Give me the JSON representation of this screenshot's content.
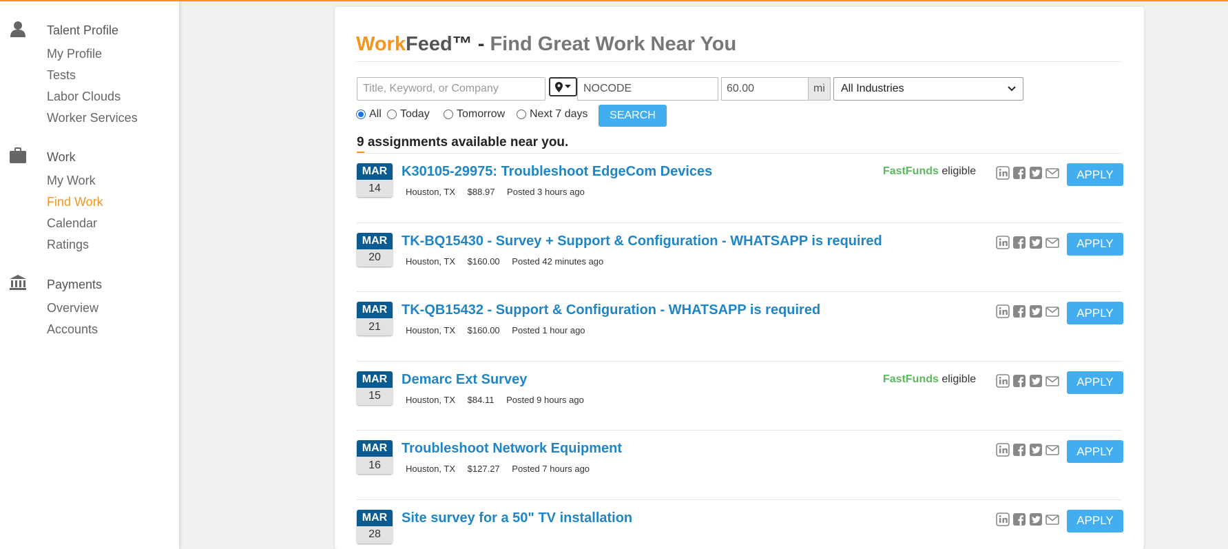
{
  "colors": {
    "accent": "#f7941d",
    "link": "#1f85c7",
    "button": "#42aef0",
    "badge_month": "#0b5b91",
    "fastfunds": "#5cb85c"
  },
  "sidebar": {
    "sections": [
      {
        "icon": "person-icon",
        "heading": "Talent Profile",
        "items": [
          {
            "label": "My Profile"
          },
          {
            "label": "Tests"
          },
          {
            "label": "Labor Clouds"
          },
          {
            "label": "Worker Services"
          }
        ]
      },
      {
        "icon": "briefcase-icon",
        "heading": "Work",
        "items": [
          {
            "label": "My Work"
          },
          {
            "label": "Find Work",
            "active": true
          },
          {
            "label": "Calendar"
          },
          {
            "label": "Ratings"
          }
        ]
      },
      {
        "icon": "bank-icon",
        "heading": "Payments",
        "items": [
          {
            "label": "Overview"
          },
          {
            "label": "Accounts"
          }
        ]
      }
    ]
  },
  "header": {
    "brand_work": "Work",
    "brand_feed": "Feed",
    "trademark": "™",
    "separator": " - ",
    "tagline": "Find Great Work Near You"
  },
  "search": {
    "keyword_placeholder": "Title, Keyword, or Company",
    "keyword_value": "",
    "zip_value": "NOCODE",
    "radius_value": "60.00",
    "radius_unit": "mi",
    "industry_selected": "All Industries",
    "date_filters": [
      {
        "label": "All",
        "checked": true
      },
      {
        "label": "Today"
      },
      {
        "label": "Tomorrow"
      },
      {
        "label": "Next 7 days"
      }
    ],
    "button_label": "SEARCH"
  },
  "results": {
    "count": "9",
    "summary": " assignments available near you."
  },
  "fastfunds": {
    "brand": "FastFunds",
    "suffix": " eligible"
  },
  "apply_label": "APPLY",
  "share_icons": [
    "linkedin-icon",
    "facebook-icon",
    "twitter-icon",
    "email-icon"
  ],
  "listings": [
    {
      "month": "MAR",
      "day": "14",
      "title": "K30105-29975: Troubleshoot EdgeCom Devices",
      "location": "Houston, TX",
      "pay": "$88.97",
      "posted": "Posted 3 hours ago",
      "fastfunds": true
    },
    {
      "month": "MAR",
      "day": "20",
      "title": "TK-BQ15430 - Survey + Support & Configuration - WHATSAPP is required",
      "location": "Houston, TX",
      "pay": "$160.00",
      "posted": "Posted 42 minutes ago",
      "fastfunds": false
    },
    {
      "month": "MAR",
      "day": "21",
      "title": "TK-QB15432 - Support & Configuration - WHATSAPP is required",
      "location": "Houston, TX",
      "pay": "$160.00",
      "posted": "Posted 1 hour ago",
      "fastfunds": false
    },
    {
      "month": "MAR",
      "day": "15",
      "title": "Demarc Ext Survey",
      "location": "Houston, TX",
      "pay": "$84.11",
      "posted": "Posted 9 hours ago",
      "fastfunds": true
    },
    {
      "month": "MAR",
      "day": "16",
      "title": "Troubleshoot Network Equipment",
      "location": "Houston, TX",
      "pay": "$127.27",
      "posted": "Posted 7 hours ago",
      "fastfunds": false
    },
    {
      "month": "MAR",
      "day": "28",
      "title": "Site survey for a 50\" TV installation",
      "location": "",
      "pay": "",
      "posted": "",
      "fastfunds": false
    }
  ]
}
